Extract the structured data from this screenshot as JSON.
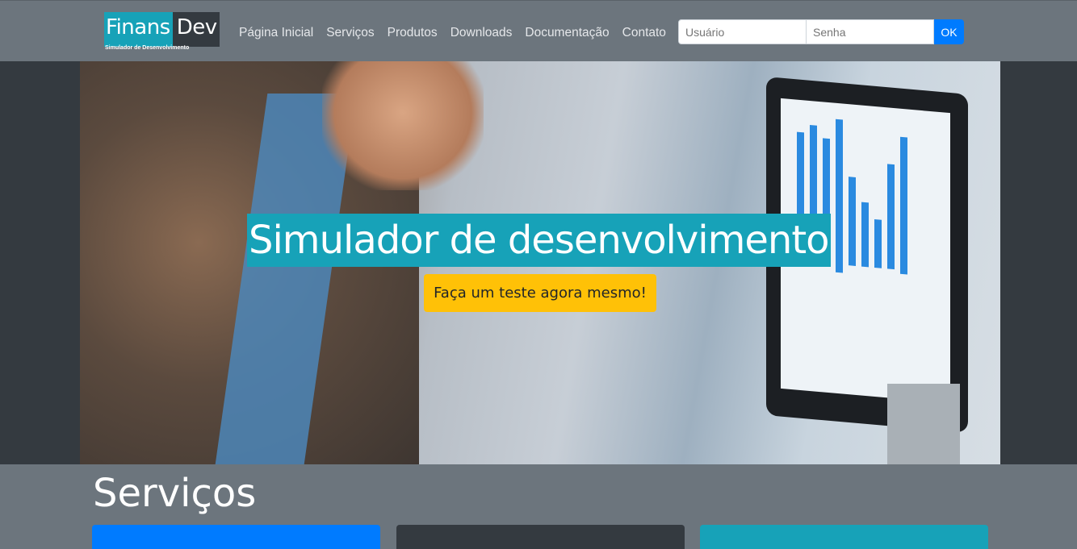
{
  "brand": {
    "name_part1": "Finans",
    "name_part2": "Dev",
    "tagline": "Simulador de Desenvolvimento"
  },
  "nav": {
    "items": [
      "Página Inicial",
      "Serviços",
      "Produtos",
      "Downloads",
      "Documentação",
      "Contato"
    ]
  },
  "login": {
    "user_placeholder": "Usuário",
    "pass_placeholder": "Senha",
    "submit_label": "OK"
  },
  "hero": {
    "title": "Simulador de desenvolvimento",
    "cta_label": "Faça um teste agora mesmo!"
  },
  "services": {
    "title": "Serviços",
    "card_colors": [
      "#007bff",
      "#343a40",
      "#17a2b8"
    ]
  },
  "colors": {
    "navbar": "#6c757d",
    "accent_teal": "#17a2b8",
    "cta_yellow": "#ffc107",
    "primary": "#007bff"
  }
}
